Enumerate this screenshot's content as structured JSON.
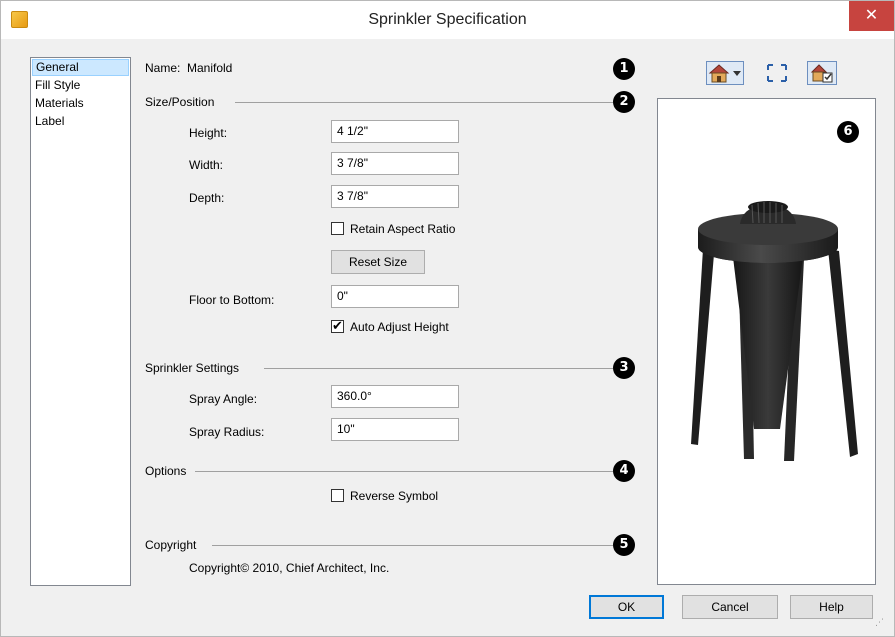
{
  "window": {
    "title": "Sprinkler Specification"
  },
  "nav": {
    "items": [
      "General",
      "Fill Style",
      "Materials",
      "Label"
    ],
    "selected": 0
  },
  "general": {
    "name_label": "Name:",
    "name_value": "Manifold",
    "size_position": {
      "title": "Size/Position",
      "height_label": "Height:",
      "height_value": "4 1/2\"",
      "width_label": "Width:",
      "width_value": "3 7/8\"",
      "depth_label": "Depth:",
      "depth_value": "3 7/8\"",
      "retain_aspect_label": "Retain Aspect Ratio",
      "retain_aspect_checked": false,
      "reset_size_label": "Reset Size",
      "floor_to_bottom_label": "Floor to Bottom:",
      "floor_to_bottom_value": "0\"",
      "auto_adjust_label": "Auto Adjust Height",
      "auto_adjust_checked": true
    },
    "sprinkler_settings": {
      "title": "Sprinkler Settings",
      "spray_angle_label": "Spray Angle:",
      "spray_angle_value": "360.0°",
      "spray_radius_label": "Spray Radius:",
      "spray_radius_value": "10\""
    },
    "options": {
      "title": "Options",
      "reverse_symbol_label": "Reverse Symbol",
      "reverse_symbol_checked": false
    },
    "copyright": {
      "title": "Copyright",
      "text": "Copyright© 2010, Chief Architect, Inc."
    }
  },
  "callouts": [
    "1",
    "2",
    "3",
    "4",
    "5",
    "6"
  ],
  "buttons": {
    "ok": "OK",
    "cancel": "Cancel",
    "help": "Help"
  },
  "icons": {
    "close": "close-icon",
    "view_house": "house-view-icon",
    "fill_window": "fill-window-icon",
    "view_options": "view-options-icon"
  },
  "colors": {
    "close": "#c7443f",
    "selected": "#cce8ff",
    "default_border": "#0078d7"
  }
}
